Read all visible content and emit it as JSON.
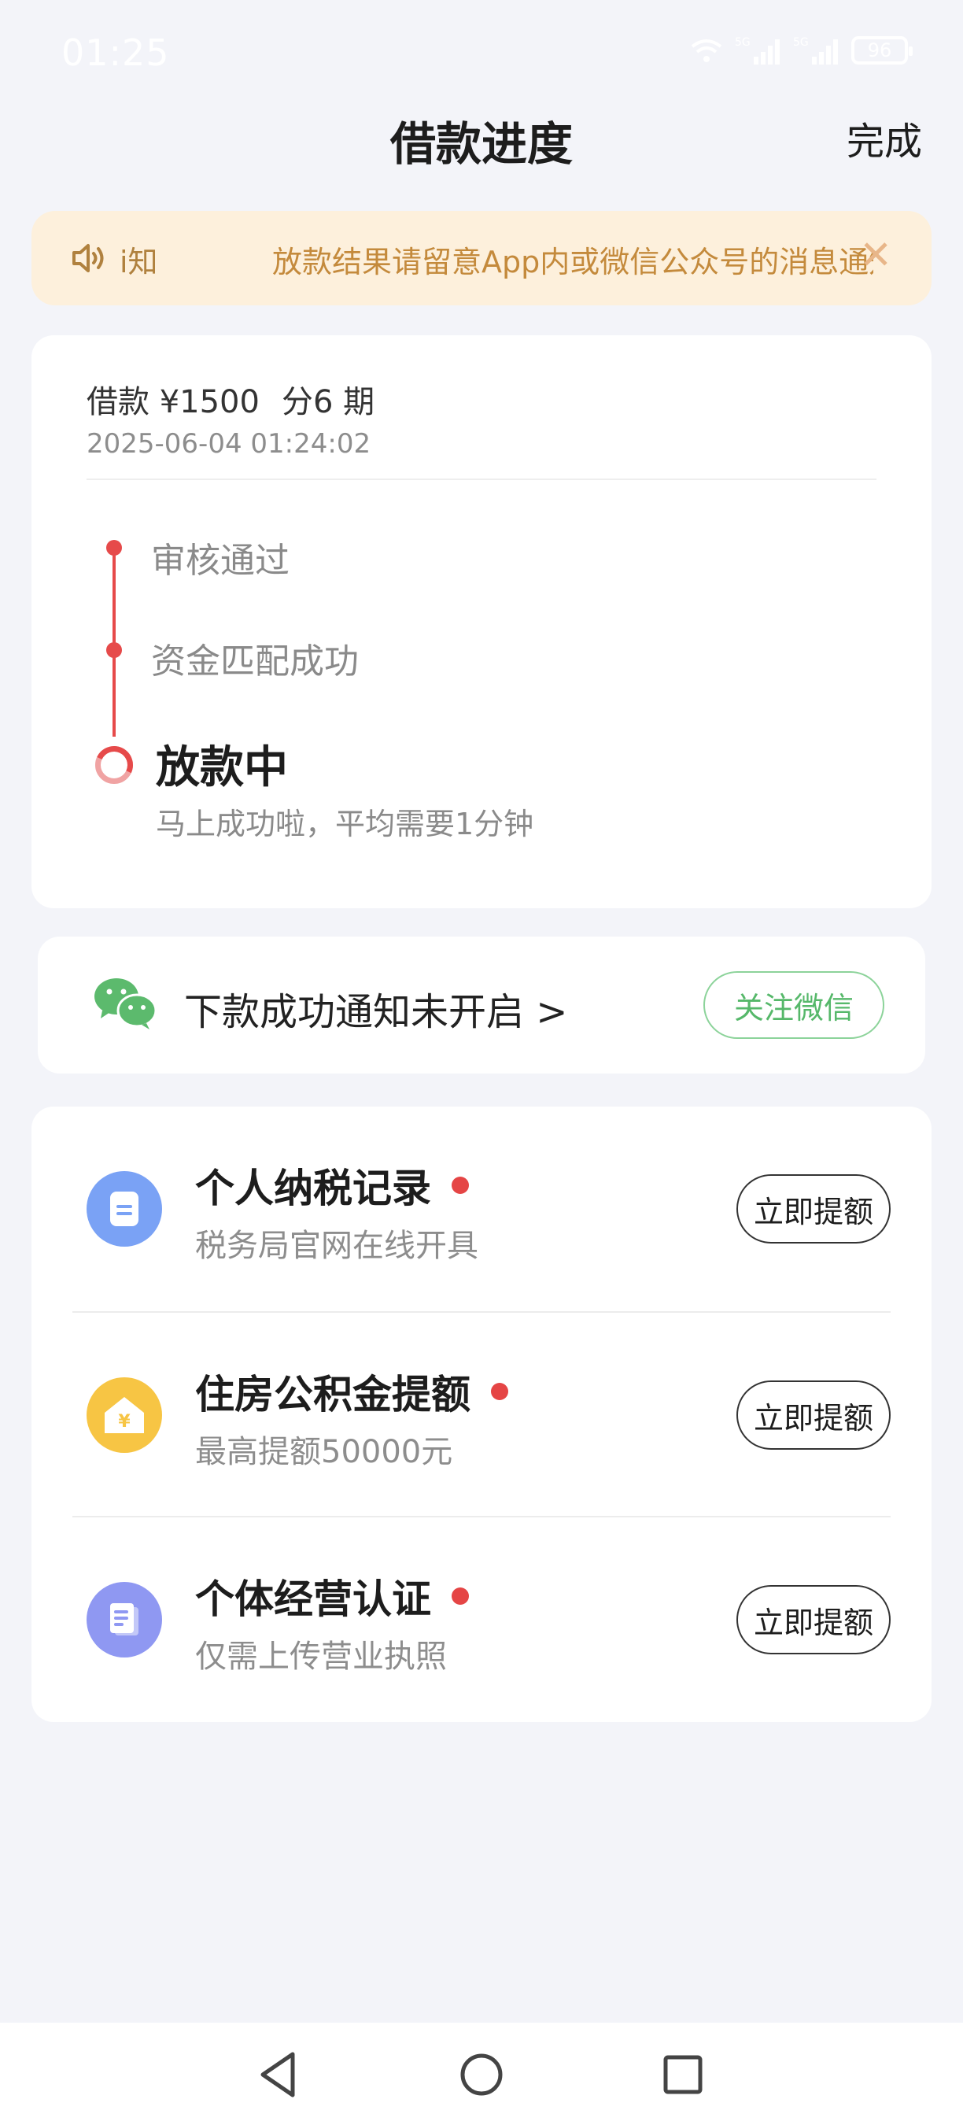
{
  "status_bar": {
    "time": "01:25",
    "network_1": "5G",
    "network_2": "5G",
    "battery": "96"
  },
  "header": {
    "title": "借款进度",
    "done_label": "完成"
  },
  "notice": {
    "prefix": "i知",
    "text": "放款结果请留意App内或微信公众号的消息通知",
    "close": "✕"
  },
  "loan": {
    "amount_label": "借款 ¥1500",
    "installments_label": "分6 期",
    "datetime": "2025-06-04 01:24:02",
    "steps": [
      {
        "label": "审核通过"
      },
      {
        "label": "资金匹配成功"
      }
    ],
    "current_step": {
      "title": "放款中",
      "subtitle": "马上成功啦，平均需要1分钟"
    }
  },
  "wechat": {
    "text": "下款成功通知未开启 >",
    "button_label": "关注微信"
  },
  "services": [
    {
      "title": "个人纳税记录",
      "subtitle": "税务局官网在线开具",
      "button_label": "立即提额"
    },
    {
      "title": "住房公积金提额",
      "subtitle": "最高提额50000元",
      "button_label": "立即提额"
    },
    {
      "title": "个体经营认证",
      "subtitle": "仅需上传营业执照",
      "button_label": "立即提额"
    }
  ],
  "colors": {
    "accent_red": "#e64a4a",
    "notice_bg": "#fdf0dc",
    "notice_text": "#c48a3c",
    "wechat_green": "#56b86a"
  }
}
